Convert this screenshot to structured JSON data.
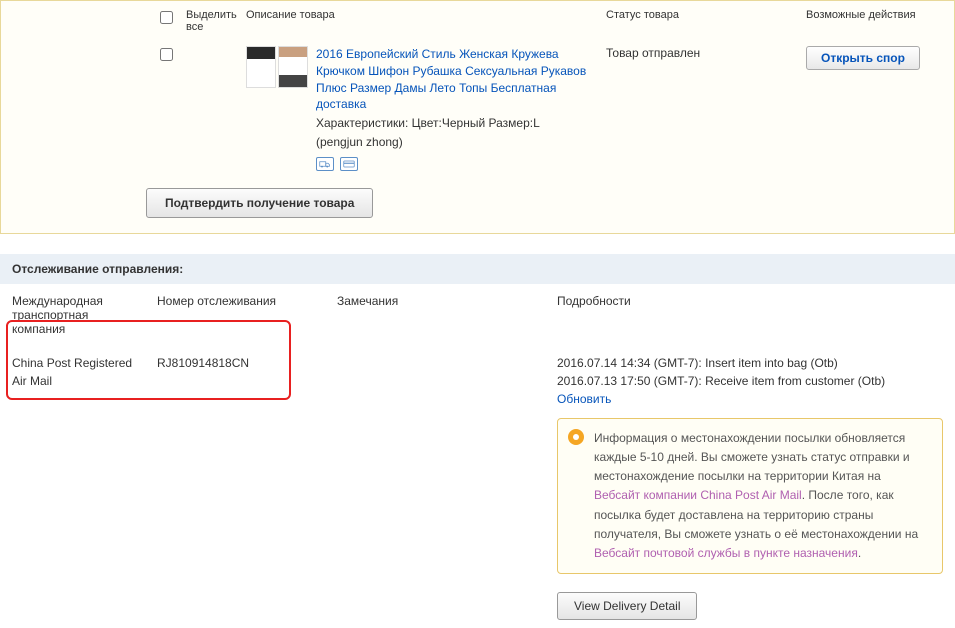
{
  "order": {
    "headers": {
      "select_all": "Выделить все",
      "description": "Описание товара",
      "status": "Статус товара",
      "actions": "Возможные действия"
    },
    "item": {
      "title": "2016 Европейский Стиль Женская Кружева Крючком Шифон Рубашка Сексуальная Рукавов Плюс Размер Дамы Лето Топы Бесплатная доставка",
      "characteristics": "Характеристики: Цвет:Черный Размер:L",
      "seller": "(pengjun zhong)",
      "status": "Товар отправлен",
      "dispute_button": "Открыть спор"
    },
    "confirm_button": "Подтвердить получение товара"
  },
  "tracking": {
    "title": "Отслеживание отправления:",
    "headers": {
      "carrier": "Международная транспортная компания",
      "tracking_number": "Номер отслеживания",
      "remarks": "Замечания",
      "details": "Подробности"
    },
    "carrier": "China Post Registered Air Mail",
    "tracking_number": "RJ810914818CN",
    "events": [
      "2016.07.14 14:34 (GMT-7): Insert item into bag (Otb)",
      "2016.07.13 17:50 (GMT-7): Receive item from customer (Otb)"
    ],
    "update_link": "Обновить",
    "info": {
      "text1": "Информация о местонахождении посылки обновляется каждые 5-10 дней. Вы сможете узнать статус отправки и местонахождение посылки на территории Китая на ",
      "link1": "Вебсайт компании China Post Air Mail",
      "text2": ". После того, как посылка будет доставлена на территорию страны получателя, Вы сможете узнать о её местонахождении на ",
      "link2": "Вебсайт почтовой службы в пункте назначения",
      "text3": "."
    },
    "delivery_button": "View Delivery Detail"
  }
}
